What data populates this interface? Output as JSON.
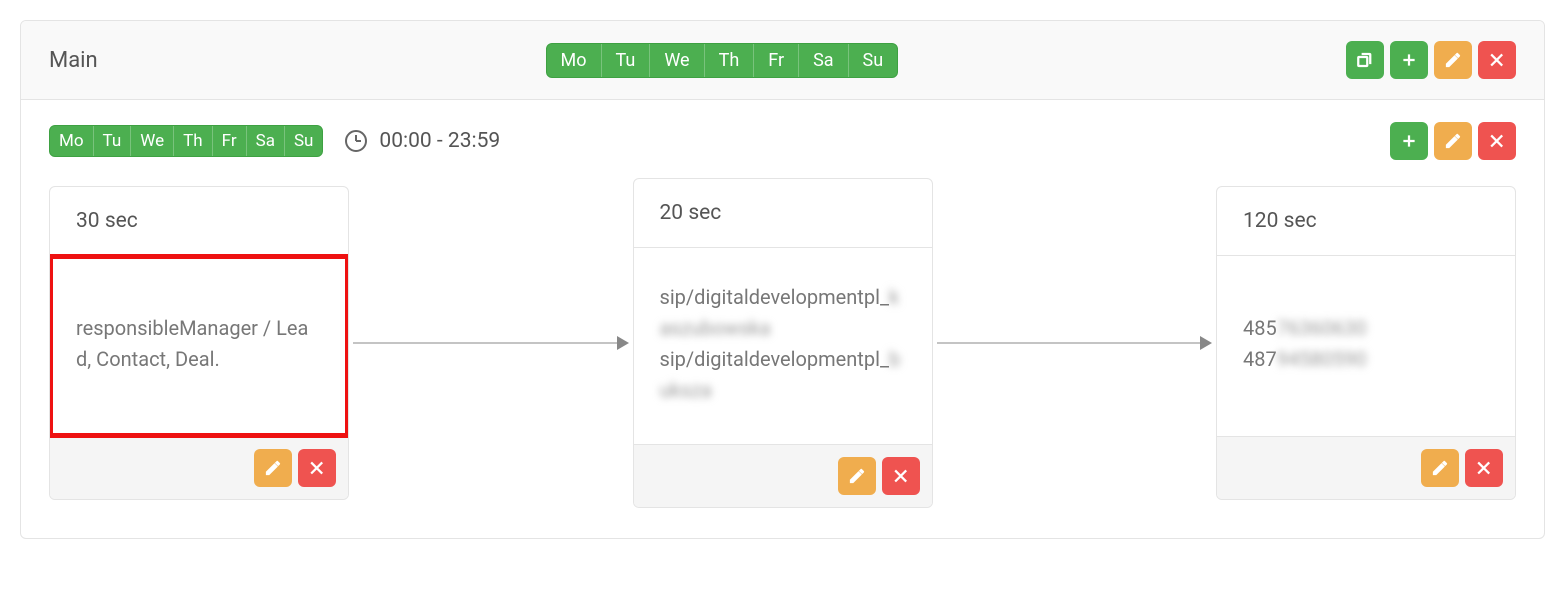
{
  "header": {
    "title": "Main",
    "days": [
      "Mo",
      "Tu",
      "We",
      "Th",
      "Fr",
      "Sa",
      "Su"
    ]
  },
  "schedule": {
    "days": [
      "Mo",
      "Tu",
      "We",
      "Th",
      "Fr",
      "Sa",
      "Su"
    ],
    "time_range": "00:00 - 23:59"
  },
  "steps": [
    {
      "duration": "30 sec",
      "lines": [
        {
          "text": "responsibleManager / Lead, Contact, Deal.",
          "tail": ""
        }
      ],
      "highlight": true
    },
    {
      "duration": "20 sec",
      "lines": [
        {
          "text": "sip/digitaldevelopmentpl_",
          "tail": "kaszubowska"
        },
        {
          "text": "sip/digitaldevelopmentpl_",
          "tail": "buksza"
        }
      ],
      "highlight": false
    },
    {
      "duration": "120 sec",
      "lines": [
        {
          "text": "485",
          "tail": "76360630"
        },
        {
          "text": "487",
          "tail": "94580590"
        }
      ],
      "highlight": false
    }
  ]
}
